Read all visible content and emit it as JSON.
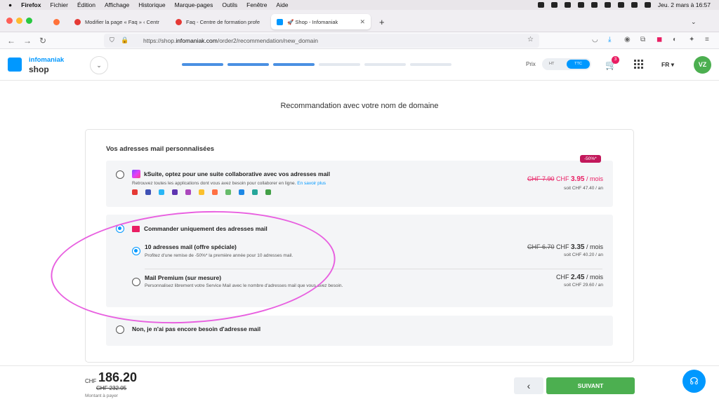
{
  "macos": {
    "app": "Firefox",
    "menu": [
      "Fichier",
      "Édition",
      "Affichage",
      "Historique",
      "Marque-pages",
      "Outils",
      "Fenêtre",
      "Aide"
    ],
    "clock": "Jeu. 2 mars à 16:57"
  },
  "browser": {
    "tabs": [
      {
        "label": "Modifier la page « Faq » ‹ Centr"
      },
      {
        "label": "Faq - Centre de formation profe"
      },
      {
        "label": "🚀 Shop - Infomaniak"
      }
    ],
    "url_prefix": "https://shop.",
    "url_domain": "infomaniak.com",
    "url_path": "/order2/recommendation/new_domain"
  },
  "header": {
    "brand_top": "infomaniak",
    "brand_bottom": "shop",
    "prix_label": "Prix",
    "toggle_ht": "HT",
    "toggle_ttc": "TTC",
    "cart_count": "3",
    "lang": "FR",
    "avatar": "VZ",
    "progress_steps": 6,
    "progress_done": 3
  },
  "page": {
    "title": "Recommandation avec votre nom de domaine",
    "section_title": "Vos adresses mail personnalisées",
    "promo_badge": "-50%*",
    "ksuite": {
      "title": "kSuite, optez pour une suite collaborative avec vos adresses mail",
      "desc": "Retrouvez toutes les applications dont vous avez besoin pour collaborer en ligne.",
      "link": "En savoir plus",
      "old_price": "CHF 7.90",
      "price_cur": "CHF",
      "price": "3.95",
      "per": "/ mois",
      "yearly": "soit CHF 47.40 / an"
    },
    "mail_only": {
      "title": "Commander uniquement des adresses mail",
      "options": [
        {
          "title": "10 adresses mail (offre spéciale)",
          "desc": "Profitez d'une remise de -50%* la première année pour 10 adresses mail.",
          "old_price": "CHF 6.70",
          "price_cur": "CHF",
          "price": "3.35",
          "per": "/ mois",
          "yearly": "soit CHF 40.20 / an",
          "selected": true
        },
        {
          "title": "Mail Premium (sur mesure)",
          "desc": "Personnalisez librement votre Service Mail avec le nombre d'adresses mail que vous avez besoin.",
          "price_cur": "CHF",
          "price": "2.45",
          "per": "/ mois",
          "yearly": "soit CHF 29.60 / an",
          "selected": false
        }
      ]
    },
    "none_option": "Non, je n'ai pas encore besoin d'adresse mail"
  },
  "footer": {
    "currency": "CHF",
    "total": "186.20",
    "old_total": "CHF 232.05",
    "label": "Montant à payer",
    "next": "SUIVANT"
  },
  "colors": {
    "accent": "#0098ff",
    "success": "#4caf50",
    "promo": "#c2185b",
    "annotation": "#e860e0"
  }
}
